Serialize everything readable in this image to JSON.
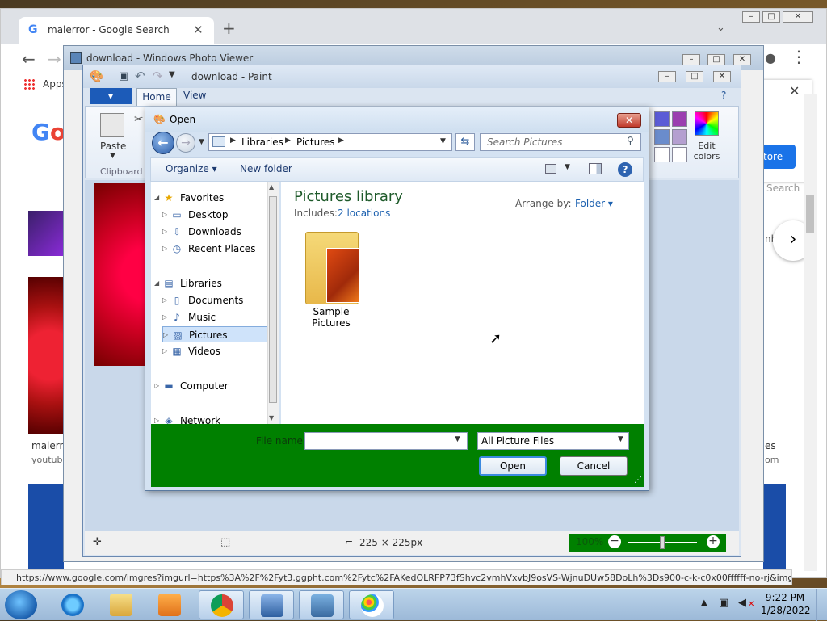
{
  "chrome": {
    "tab_title": "malerror - Google Search",
    "tab_favicon": "G",
    "new_tab": "+",
    "close_tab": "✕",
    "bookmarks_apps": "Apps",
    "google_logo_part1": "G",
    "google_logo_part2": "o",
    "result_caption": "malerro",
    "result_source": "youtube",
    "right_store_btn": "tore",
    "right_search_hint": "Search",
    "right_nb": "nb",
    "right_es": "es",
    "right_om": "om",
    "status_url": "https://www.google.com/imgres?imgurl=https%3A%2F%2Fyt3.ggpht.com%2Fytc%2FAKedOLRFP73fShvc2vmhVxvbJ9osVS-WjnuDUw58DoLh%3Ds900-c-k-c0x00ffffff-no-rj&imgre..."
  },
  "photoviewer": {
    "title": "download - Windows Photo Viewer"
  },
  "paint": {
    "title": "download - Paint",
    "menu_label": "▾",
    "tab_home": "Home",
    "tab_view": "View",
    "paste_label": "Paste",
    "clipboard_label": "Clipboard",
    "edit_colors_label": "Edit colors",
    "image_size": "225 × 225px",
    "zoom": "100%",
    "color_swatches": [
      "#5b5bd6",
      "#9b3fb0",
      "#6a8ccc",
      "#b49fd0",
      "#ffffff",
      "#ffffff"
    ]
  },
  "dialog": {
    "title": "Open",
    "breadcrumb": [
      "Libraries",
      "Pictures"
    ],
    "search_placeholder": "Search Pictures",
    "organize": "Organize",
    "new_folder": "New folder",
    "nav_tree": [
      {
        "label": "Favorites",
        "icon": "star-icon",
        "level": 0
      },
      {
        "label": "Desktop",
        "icon": "desktop-icon",
        "level": 1
      },
      {
        "label": "Downloads",
        "icon": "downloads-icon",
        "level": 1
      },
      {
        "label": "Recent Places",
        "icon": "recent-places-icon",
        "level": 1
      },
      {
        "label": "Libraries",
        "icon": "libraries-icon",
        "level": 0
      },
      {
        "label": "Documents",
        "icon": "documents-icon",
        "level": 1
      },
      {
        "label": "Music",
        "icon": "music-icon",
        "level": 1
      },
      {
        "label": "Pictures",
        "icon": "pictures-icon",
        "level": 1,
        "selected": true
      },
      {
        "label": "Videos",
        "icon": "videos-icon",
        "level": 1
      },
      {
        "label": "Computer",
        "icon": "computer-icon",
        "level": 0
      },
      {
        "label": "Network",
        "icon": "network-icon",
        "level": 0
      }
    ],
    "library_title": "Pictures library",
    "includes_label": "Includes:",
    "includes_link": "2 locations",
    "arrange_label": "Arrange by:",
    "arrange_value": "Folder",
    "folder_name": "Sample Pictures",
    "file_name_label": "File name:",
    "file_name_value": "",
    "file_type": "All Picture Files",
    "open_btn": "Open",
    "cancel_btn": "Cancel"
  },
  "taskbar": {
    "time": "9:22 PM",
    "date": "1/28/2022"
  }
}
